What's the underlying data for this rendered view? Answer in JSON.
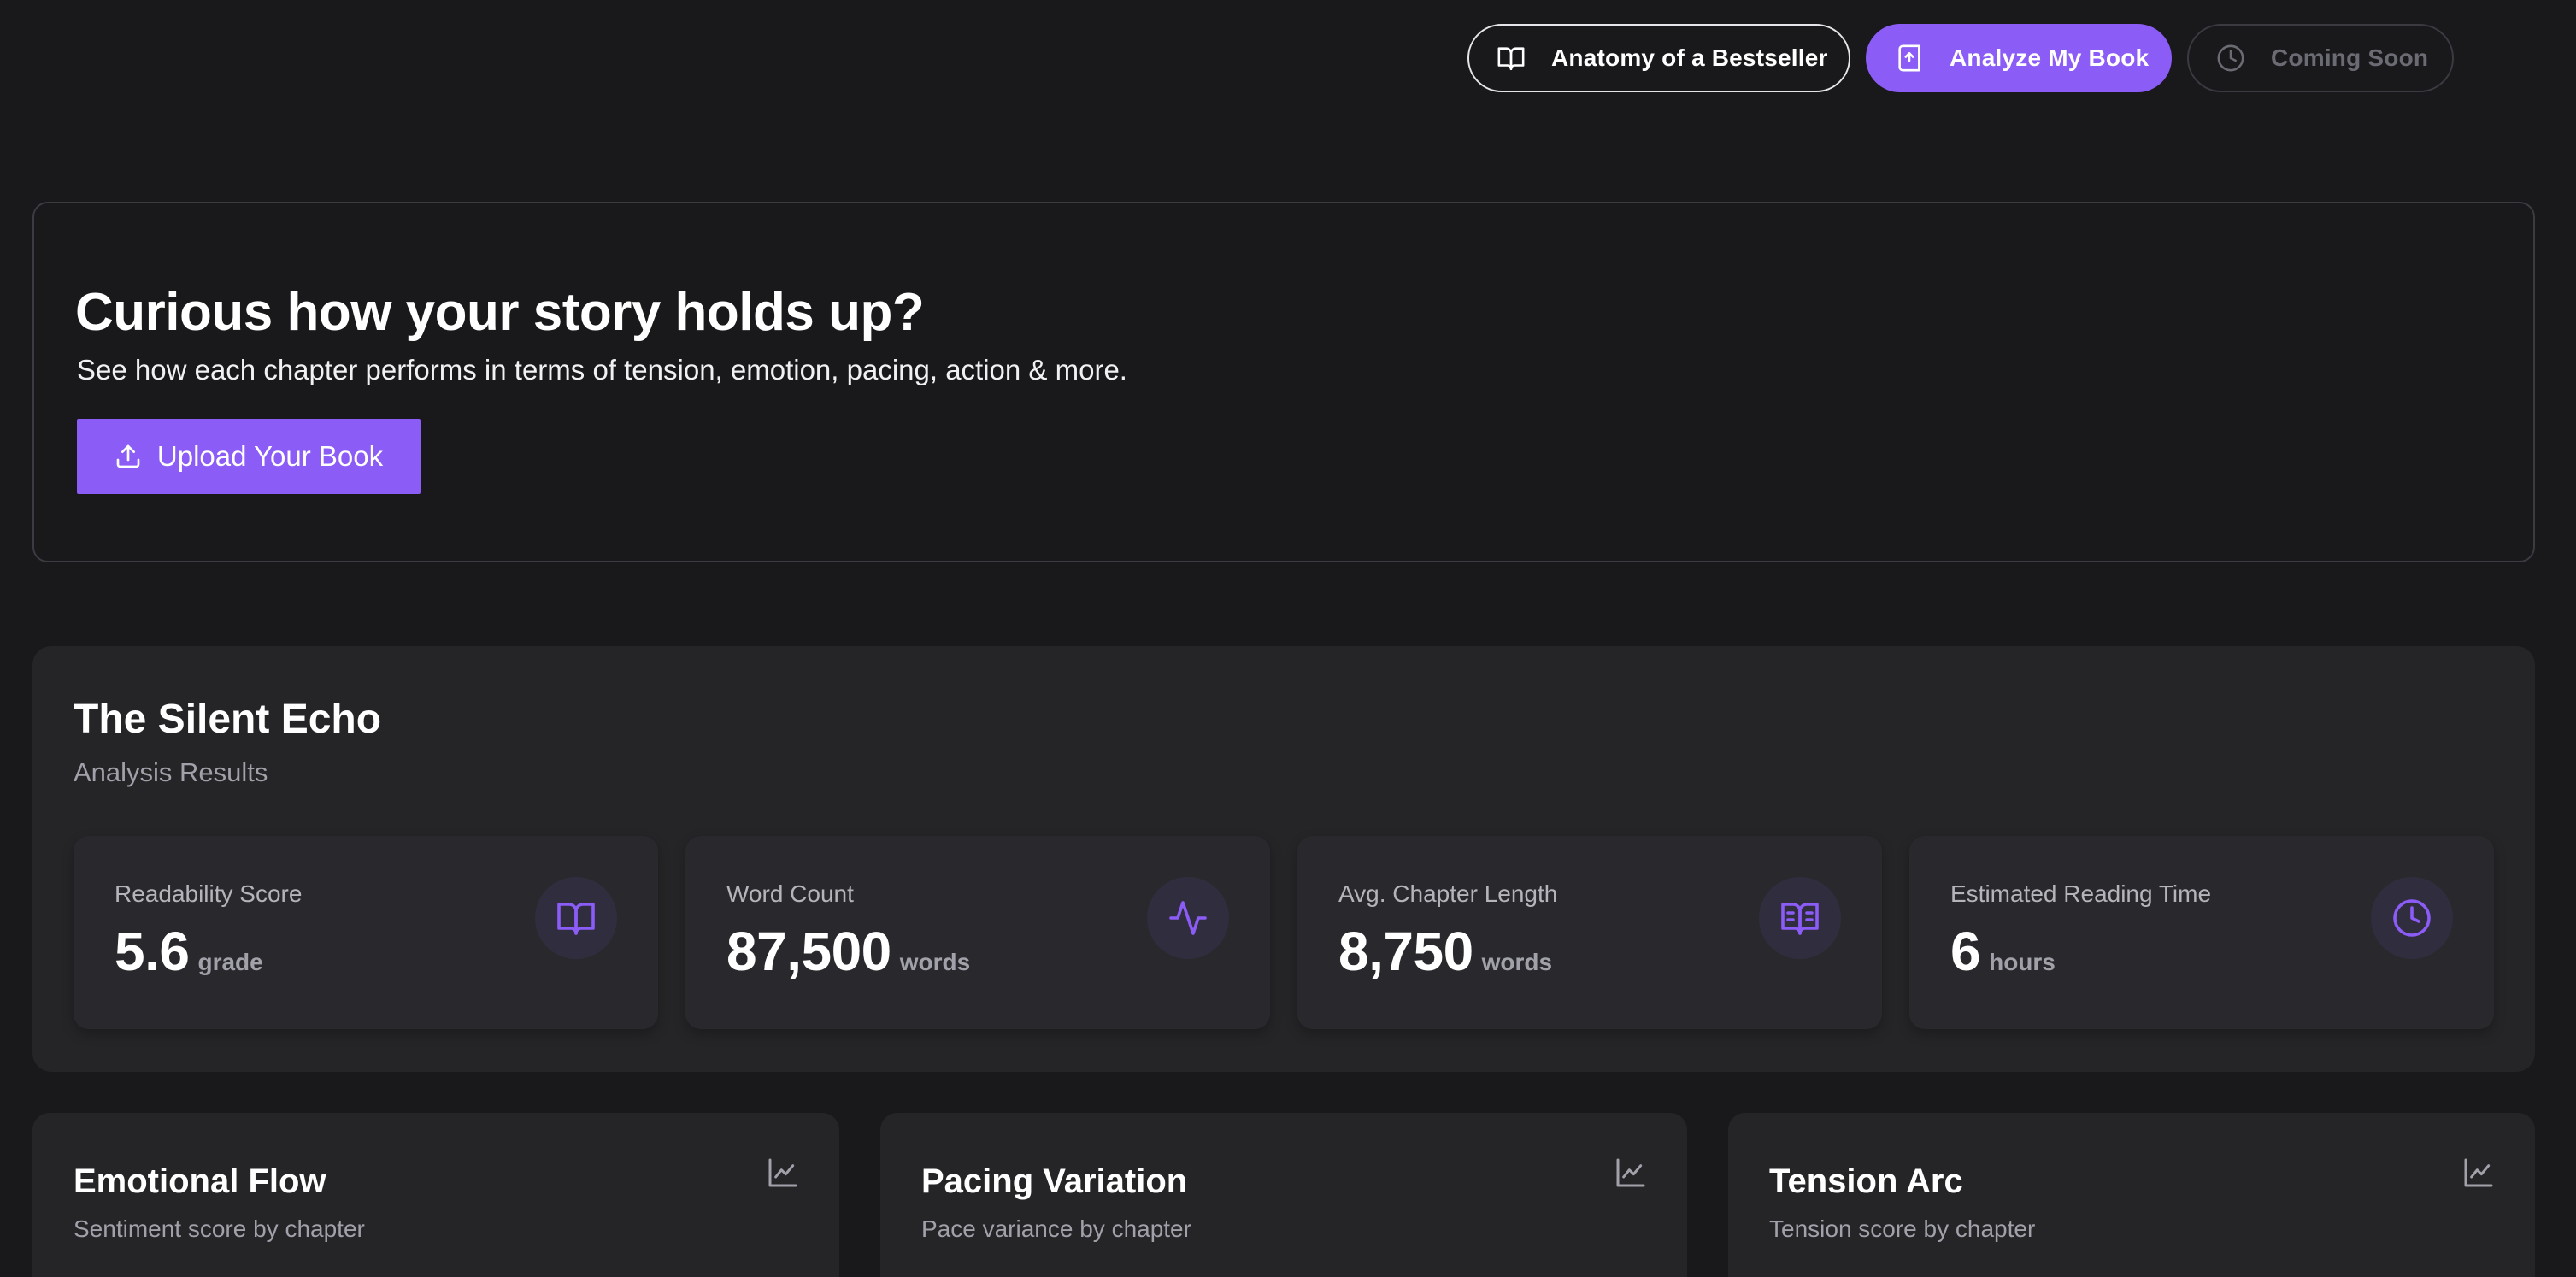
{
  "nav": {
    "anatomy_label": "Anatomy of a Bestseller",
    "analyze_label": "Analyze My Book",
    "coming_soon_label": "Coming Soon"
  },
  "hero": {
    "title": "Curious how your story holds up?",
    "subtitle": "See how each chapter performs in terms of tension, emotion, pacing, action & more.",
    "upload_label": "Upload Your Book"
  },
  "results": {
    "book_title": "The Silent Echo",
    "subtitle": "Analysis Results",
    "stats": [
      {
        "label": "Readability Score",
        "value": "5.6",
        "unit": "grade",
        "icon": "book-open-icon"
      },
      {
        "label": "Word Count",
        "value": "87,500",
        "unit": "words",
        "icon": "activity-icon"
      },
      {
        "label": "Avg. Chapter Length",
        "value": "8,750",
        "unit": "words",
        "icon": "book-text-icon"
      },
      {
        "label": "Estimated Reading Time",
        "value": "6",
        "unit": "hours",
        "icon": "clock-icon"
      }
    ]
  },
  "charts": [
    {
      "title": "Emotional Flow",
      "subtitle": "Sentiment score by chapter",
      "icon": "line-chart-icon"
    },
    {
      "title": "Pacing Variation",
      "subtitle": "Pace variance by chapter",
      "icon": "line-chart-icon"
    },
    {
      "title": "Tension Arc",
      "subtitle": "Tension score by chapter",
      "icon": "line-chart-icon"
    }
  ],
  "colors": {
    "accent": "#8b5cf6",
    "background": "#19191c",
    "card": "#252528",
    "muted_text": "#a1a1aa"
  }
}
